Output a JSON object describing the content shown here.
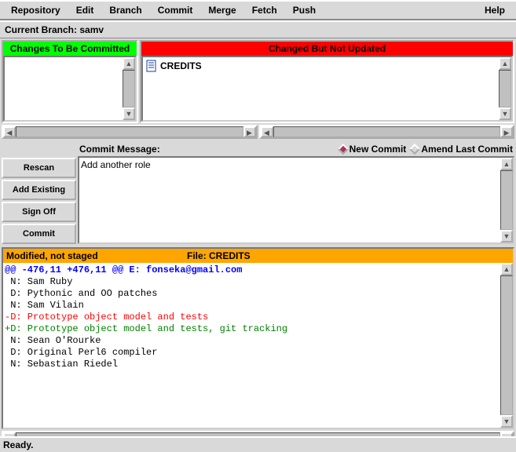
{
  "menu": {
    "items": [
      "Repository",
      "Edit",
      "Branch",
      "Commit",
      "Merge",
      "Fetch",
      "Push"
    ],
    "help": "Help"
  },
  "branch_bar": {
    "label": "Current Branch:",
    "value": "samv"
  },
  "staged": {
    "header": "Changes To Be Committed",
    "files": []
  },
  "unstaged": {
    "header": "Changed But Not Updated",
    "files": [
      {
        "icon": "file-icon",
        "name": "CREDITS"
      }
    ]
  },
  "buttons": {
    "rescan": "Rescan",
    "add_existing": "Add Existing",
    "sign_off": "Sign Off",
    "commit": "Commit"
  },
  "commit": {
    "label": "Commit Message:",
    "new_commit": "New Commit",
    "amend": "Amend Last Commit",
    "message": "Add another role",
    "mode": "new"
  },
  "diff": {
    "status": "Modified, not staged",
    "file_label": "File:",
    "file": "CREDITS",
    "lines": [
      {
        "t": "hunk",
        "s": "@@ -476,11 +476,11 @@ E: fonseka@gmail.com"
      },
      {
        "t": "ctx",
        "s": ""
      },
      {
        "t": "ctx",
        "s": " N: Sam Ruby"
      },
      {
        "t": "ctx",
        "s": " D: Pythonic and OO patches"
      },
      {
        "t": "ctx",
        "s": ""
      },
      {
        "t": "ctx",
        "s": " N: Sam Vilain"
      },
      {
        "t": "del",
        "s": "-D: Prototype object model and tests"
      },
      {
        "t": "add",
        "s": "+D: Prototype object model and tests, git tracking"
      },
      {
        "t": "ctx",
        "s": ""
      },
      {
        "t": "ctx",
        "s": " N: Sean O'Rourke"
      },
      {
        "t": "ctx",
        "s": " D: Original Perl6 compiler"
      },
      {
        "t": "ctx",
        "s": ""
      },
      {
        "t": "ctx",
        "s": " N: Sebastian Riedel"
      }
    ]
  },
  "status": "Ready."
}
